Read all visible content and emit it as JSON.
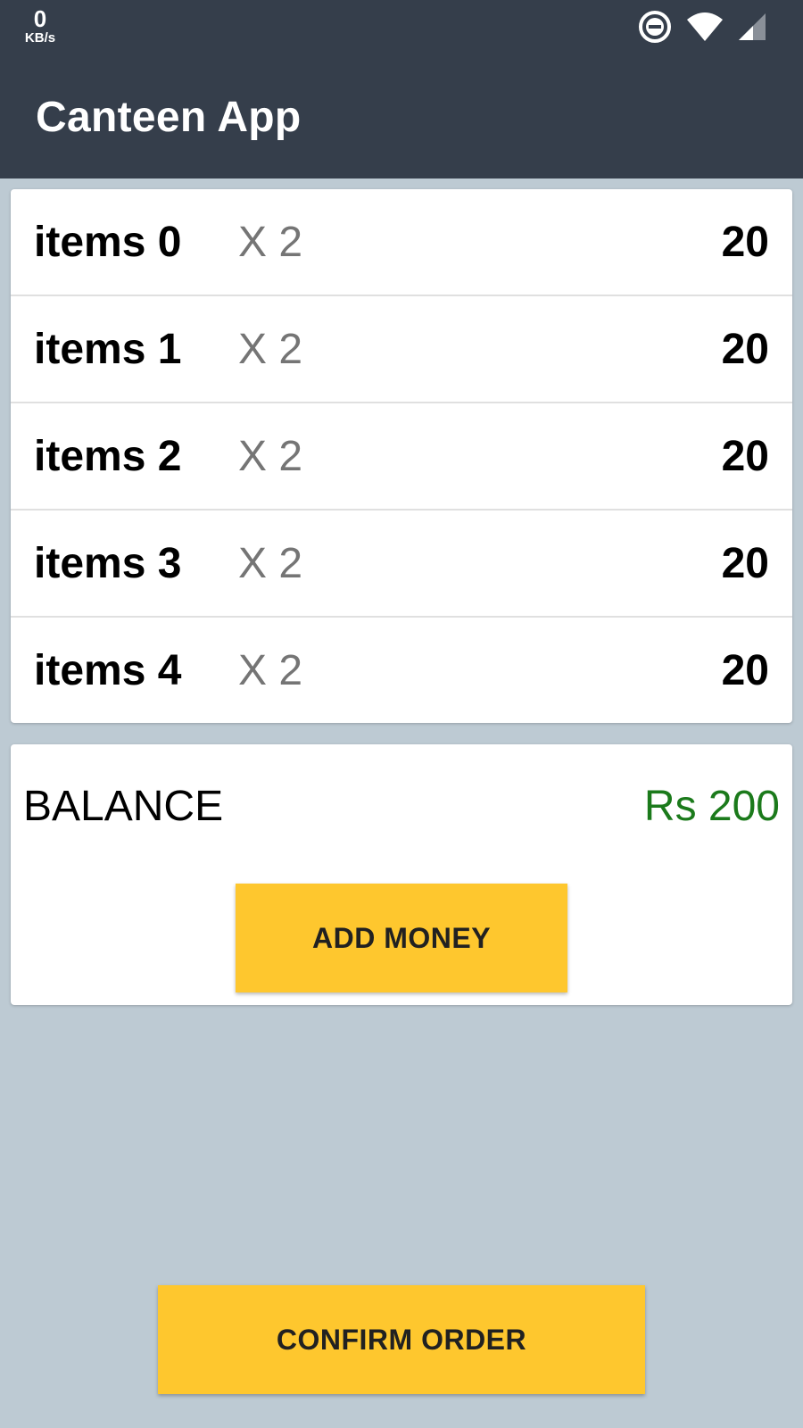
{
  "status_bar": {
    "net_speed_value": "0",
    "net_speed_unit": "KB/s",
    "icons": [
      "do-not-disturb-icon",
      "wifi-icon",
      "cellular-signal-icon"
    ]
  },
  "app_bar": {
    "title": "Canteen App"
  },
  "items": [
    {
      "name": "items 0",
      "qty": "X 2",
      "price": "20"
    },
    {
      "name": "items 1",
      "qty": "X 2",
      "price": "20"
    },
    {
      "name": "items 2",
      "qty": "X 2",
      "price": "20"
    },
    {
      "name": "items 3",
      "qty": "X 2",
      "price": "20"
    },
    {
      "name": "items 4",
      "qty": "X 2",
      "price": "20"
    }
  ],
  "balance": {
    "label": "BALANCE",
    "value": "Rs 200",
    "add_money_label": "ADD MONEY"
  },
  "confirm_order_label": "CONFIRM ORDER",
  "colors": {
    "app_bar": "#353e4b",
    "background": "#bdcad3",
    "accent_button": "#fec72e",
    "balance_value": "#1b7a1b"
  }
}
